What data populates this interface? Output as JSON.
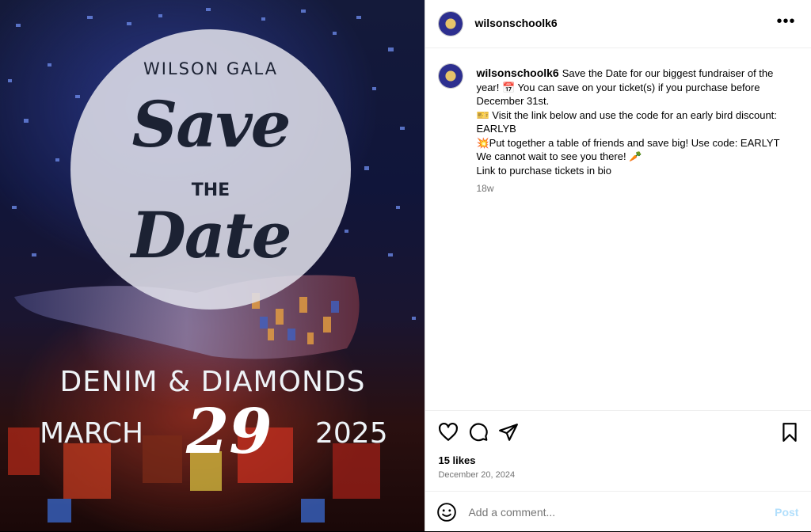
{
  "poster": {
    "gala": "WILSON GALA",
    "save": "Save",
    "the": "THE",
    "date": "Date",
    "subtitle": "DENIM & DIAMONDS",
    "month": "MARCH",
    "day": "29",
    "year": "2025"
  },
  "header": {
    "username": "wilsonschoolk6",
    "more_icon": "more-horizontal-icon"
  },
  "caption": {
    "username": "wilsonschoolk6",
    "line1": "Save the Date for our biggest fundraiser of the year! 📅 You can save on your ticket(s) if you purchase before December 31st.",
    "line2": "🎫 Visit the link below and use the code for an early bird discount: EARLYB",
    "line3": "💥Put together a table of friends and save big! Use code: EARLYT",
    "line4": "We cannot wait to see you there! 🥕",
    "line5": "Link to purchase tickets in bio",
    "age": "18w"
  },
  "actions": {
    "like_icon": "heart-icon",
    "comment_icon": "comment-icon",
    "share_icon": "send-icon",
    "save_icon": "bookmark-icon"
  },
  "stats": {
    "likes": "15 likes",
    "date": "December 20, 2024"
  },
  "comment": {
    "placeholder": "Add a comment...",
    "post_label": "Post"
  }
}
